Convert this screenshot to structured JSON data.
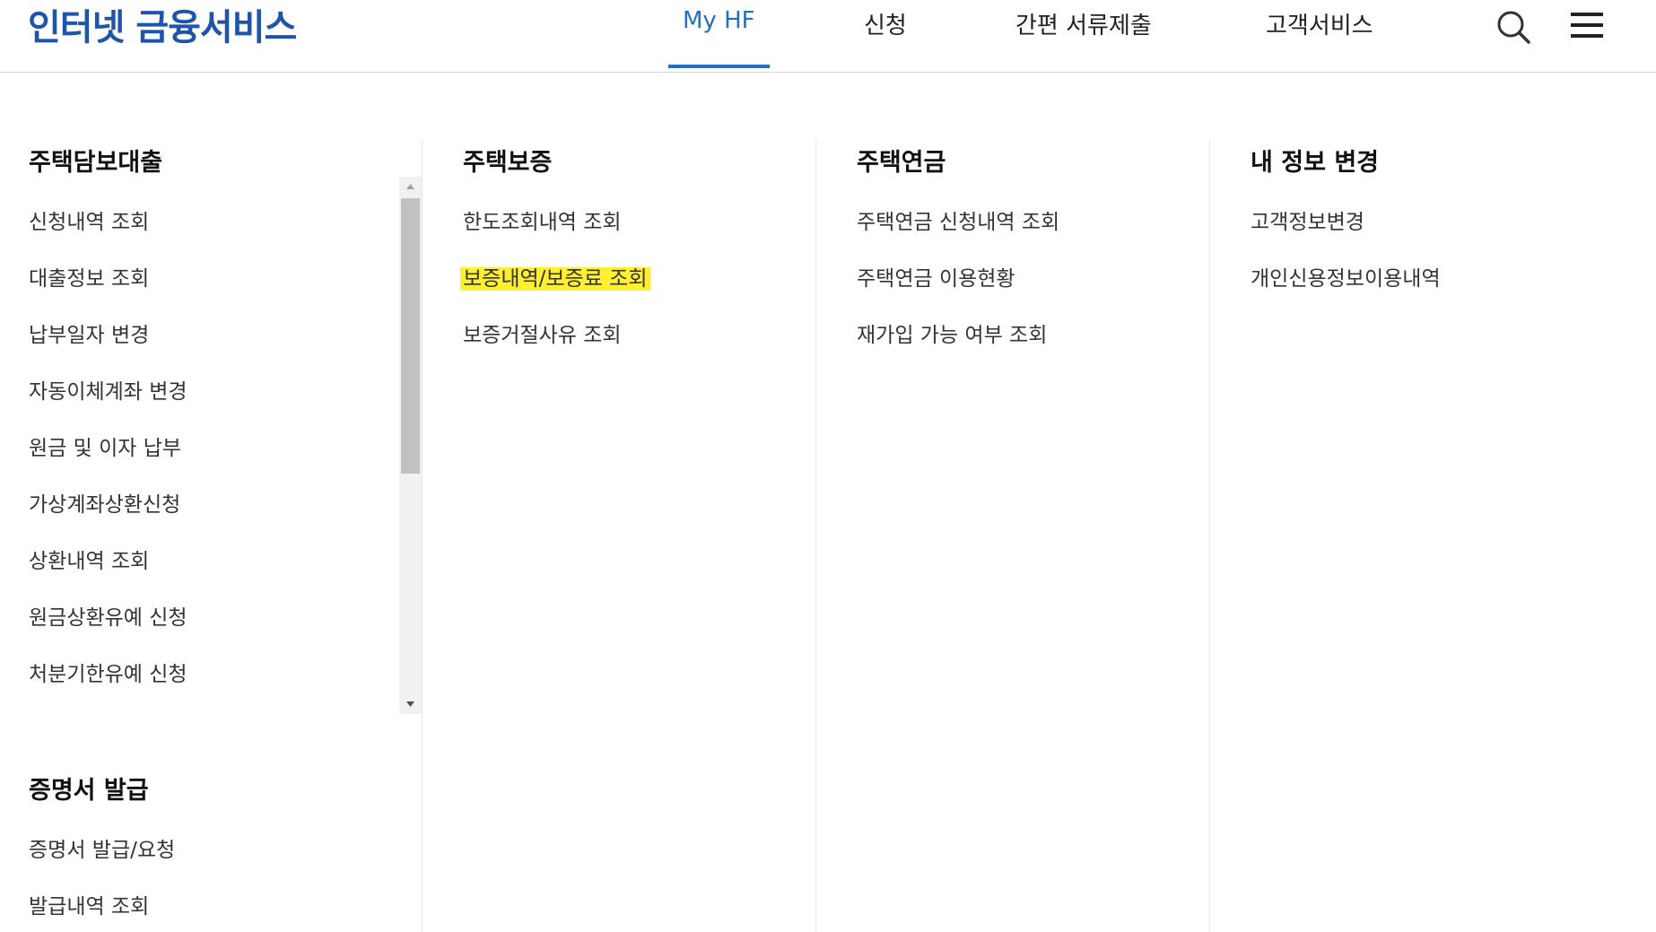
{
  "header": {
    "logo": "인터넷 금융서비스",
    "nav": [
      {
        "label": "My HF",
        "active": true
      },
      {
        "label": "신청"
      },
      {
        "label": "간편 서류제출"
      },
      {
        "label": "고객서비스"
      }
    ],
    "icons": [
      "search-icon",
      "hamburger-menu-icon"
    ],
    "accent_color": "#1f6fc4",
    "logo_color": "#1f55a8"
  },
  "columns": {
    "loan": {
      "title": "주택담보대출",
      "items": [
        "신청내역 조회",
        "대출정보 조회",
        "납부일자 변경",
        "자동이체계좌 변경",
        "원금 및 이자 납부",
        "가상계좌상환신청",
        "상환내역 조회",
        "원금상환유예 신청",
        "처분기한유예 신청"
      ]
    },
    "certificate": {
      "title": "증명서 발급",
      "items": [
        "증명서 발급/요청",
        "발급내역 조회"
      ]
    },
    "guarantee": {
      "title": "주택보증",
      "items": [
        "한도조회내역 조회",
        "보증내역/보증료 조회",
        "보증거절사유 조회"
      ],
      "highlighted_index": 1,
      "highlight_color": "#ffef33"
    },
    "pension": {
      "title": "주택연금",
      "items": [
        "주택연금 신청내역 조회",
        "주택연금 이용현황",
        "재가입 가능 여부 조회"
      ]
    },
    "myinfo": {
      "title": "내 정보 변경",
      "items": [
        "고객정보변경",
        "개인신용정보이용내역"
      ]
    }
  }
}
